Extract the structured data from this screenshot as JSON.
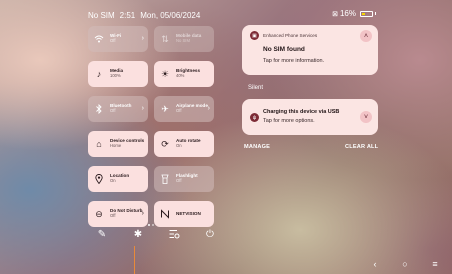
{
  "status_bar": {
    "carrier": "No SIM",
    "time": "2:51",
    "date": "Mon, 05/06/2024",
    "battery_percent": "16%"
  },
  "quick_settings": {
    "tiles": [
      {
        "label": "Wi-Fi",
        "sub": "Off",
        "icon": "wifi-icon",
        "state": "off",
        "arrow": true
      },
      {
        "label": "Mobile data",
        "sub": "No SIM",
        "icon": "mobile-data-icon",
        "state": "dim",
        "arrow": false
      },
      {
        "label": "Media",
        "sub": "100%",
        "icon": "music-note-icon",
        "state": "on",
        "arrow": false
      },
      {
        "label": "Brightness",
        "sub": "40%",
        "icon": "brightness-icon",
        "state": "on",
        "arrow": false
      },
      {
        "label": "Bluetooth",
        "sub": "Off",
        "icon": "bluetooth-icon",
        "state": "off",
        "arrow": true
      },
      {
        "label": "Airplane mode",
        "sub": "Off",
        "icon": "airplane-icon",
        "state": "off",
        "arrow": true
      },
      {
        "label": "Device controls",
        "sub": "Home",
        "icon": "home-icon",
        "state": "on",
        "arrow": false
      },
      {
        "label": "Auto rotate",
        "sub": "On",
        "icon": "auto-rotate-icon",
        "state": "on",
        "arrow": false
      },
      {
        "label": "Location",
        "sub": "On",
        "icon": "location-icon",
        "state": "on",
        "arrow": false
      },
      {
        "label": "Flashlight",
        "sub": "Off",
        "icon": "flashlight-icon",
        "state": "off",
        "arrow": false
      },
      {
        "label": "Do Not Disturb",
        "sub": "Off",
        "icon": "do-not-disturb-icon",
        "state": "on",
        "arrow": true
      },
      {
        "label": "NETVISION",
        "sub": "",
        "icon": "netvision-icon",
        "state": "on",
        "arrow": false
      }
    ]
  },
  "bottom_actions": {
    "edit": "pencil-icon",
    "settings": "gear-icon",
    "list": "list-settings-icon",
    "power": "power-icon"
  },
  "notifications": {
    "first": {
      "app": "Enhanced Phone Services",
      "title": "No SIM found",
      "body": "Tap for more information."
    },
    "silent_label": "Silent",
    "second": {
      "title": "Charging this device via USB",
      "body": "Tap for more options."
    },
    "manage_label": "MANAGE",
    "clear_label": "CLEAR ALL"
  },
  "nav": {
    "back": "back-icon",
    "home": "home-circle-icon",
    "recents": "recents-icon"
  },
  "colors": {
    "tile_on": "#fbe0df",
    "notification_bg": "#fbe5e3",
    "accent_dark": "#7d2b36"
  }
}
